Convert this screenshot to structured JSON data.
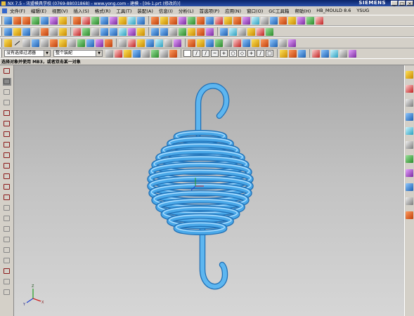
{
  "window": {
    "title": "NX 7.5 - 讯盟模具学校 (0769-88031868) - www.yong.com - 建模 - [06-1.prt (修改的)]",
    "brand": "SIEMENS",
    "controls": [
      "_",
      "□",
      "×"
    ]
  },
  "menu": [
    "文件(F)",
    "编辑(E)",
    "视图(V)",
    "插入(S)",
    "格式(R)",
    "工具(T)",
    "装配(A)",
    "信息(I)",
    "分析(L)",
    "首选项(P)",
    "应用(N)",
    "窗口(O)",
    "GC工具箱",
    "帮助(H)",
    "HB_MOULD 8.6",
    "YSUG"
  ],
  "selection_bar": {
    "filter": "没有选择过滤器",
    "scope": "整个装配"
  },
  "cue_line": "选择对象并使用 MB3，或者双击某一对象",
  "viewport": {
    "background_top": "#a8a8a8",
    "background_bottom": "#d6d6d6",
    "model_color": "#4aa8e8",
    "model_shadow": "#1f6fb5",
    "model": "extension-spring",
    "triad": "wcs-triad-icon"
  }
}
